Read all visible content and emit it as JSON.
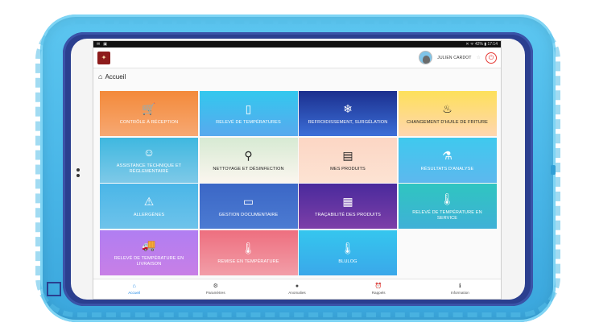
{
  "status_bar": {
    "left_icons": [
      "✉",
      "▣"
    ],
    "right_text": "✕ ᯤ 42% ▮ 17:14"
  },
  "app_bar": {
    "logo_text": "✦",
    "user_name": "JULIEN CARDOT",
    "power_symbol": "⏻",
    "star_symbol": "☆"
  },
  "breadcrumb": {
    "home_symbol": "⌂",
    "label": "Accueil"
  },
  "tiles": [
    {
      "label": "CONTRÔLE À RÉCEPTION",
      "icon": "🛒",
      "icon_name": "cart-check-icon"
    },
    {
      "label": "RELEVÉ DE TEMPÉRATURES",
      "icon": "▯",
      "icon_name": "fridge-icon"
    },
    {
      "label": "REFROIDISSEMENT, SURGÉLATION",
      "icon": "❄",
      "icon_name": "thermometer-snow-icon"
    },
    {
      "label": "CHANGEMENT D'HUILE DE FRITURE",
      "icon": "♨",
      "icon_name": "fryer-icon"
    },
    {
      "label": "ASSISTANCE TECHNIQUE ET RÈGLEMENTAIRE",
      "icon": "☺",
      "icon_name": "support-headset-icon"
    },
    {
      "label": "NETTOYAGE ET DÉSINFECTION",
      "icon": "⚲",
      "icon_name": "cleaning-icon"
    },
    {
      "label": "MES PRODUITS",
      "icon": "▤",
      "icon_name": "clipboard-list-icon"
    },
    {
      "label": "RÉSULTATS D'ANALYSE",
      "icon": "⚗",
      "icon_name": "flask-icon"
    },
    {
      "label": "ALLERGÈNES",
      "icon": "⚠",
      "icon_name": "warning-icon"
    },
    {
      "label": "GESTION DOCUMENTAIRE",
      "icon": "▭",
      "icon_name": "folder-icon"
    },
    {
      "label": "TRAÇABILITÉ DES PRODUITS",
      "icon": "▦",
      "icon_name": "qr-code-icon"
    },
    {
      "label": "RELEVÉ DE TEMPÉRATURE EN SERVICE",
      "icon": "🌡",
      "icon_name": "thermometer-icon"
    },
    {
      "label": "RELEVÉ DE TEMPÉRATURE EN LIVRAISON",
      "icon": "🚚",
      "icon_name": "delivery-truck-icon"
    },
    {
      "label": "REMISE EN TEMPÉRATURE",
      "icon": "🌡",
      "icon_name": "thermometer-heat-icon"
    },
    {
      "label": "BLULOG",
      "icon": "🌡",
      "icon_name": "blulog-sensor-icon"
    }
  ],
  "bottom_nav": [
    {
      "label": "Accueil",
      "icon": "⌂",
      "icon_name": "home-icon",
      "active": true
    },
    {
      "label": "Paramètres",
      "icon": "⚙",
      "icon_name": "gear-icon",
      "active": false
    },
    {
      "label": "Anomalies",
      "icon": "●",
      "icon_name": "alert-circle-icon",
      "active": false
    },
    {
      "label": "Rappels",
      "icon": "⏰",
      "icon_name": "alarm-clock-icon",
      "active": false
    },
    {
      "label": "Information",
      "icon": "ℹ",
      "icon_name": "info-icon",
      "active": false
    }
  ]
}
